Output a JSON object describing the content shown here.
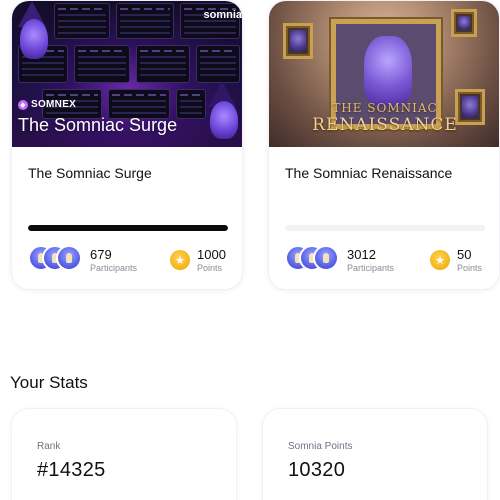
{
  "quests": [
    {
      "banner": {
        "brand_chip": "SOMNEX",
        "brand_corner": "somnia",
        "title": "The Somniac Surge"
      },
      "title": "The Somniac Surge",
      "progress": 1.0,
      "participants": {
        "value": "679",
        "label": "Participants"
      },
      "points": {
        "value": "1000",
        "label": "Points"
      }
    },
    {
      "banner": {
        "title_line_1": "THE SOMNIAC",
        "title_line_2": "RENAISSANCE"
      },
      "title": "The Somniac Renaissance",
      "progress": 0.0,
      "participants": {
        "value": "3012",
        "label": "Participants"
      },
      "points": {
        "value": "50",
        "label": "Points"
      }
    }
  ],
  "stats": {
    "title": "Your Stats",
    "rank": {
      "label": "Rank",
      "value": "#14325"
    },
    "somnia_points": {
      "label": "Somnia Points",
      "value": "10320"
    }
  },
  "icons": {
    "coin": "star-coin-icon",
    "avatars": "participant-avatar-icon",
    "brand": "somnex-logo-icon"
  },
  "colors": {
    "progress_fill": "#0b0b0f",
    "progress_track": "#f1f2f4",
    "coin": "#f4b518",
    "avatar": "#5a63e8",
    "label_gray": "#8a8d98"
  }
}
